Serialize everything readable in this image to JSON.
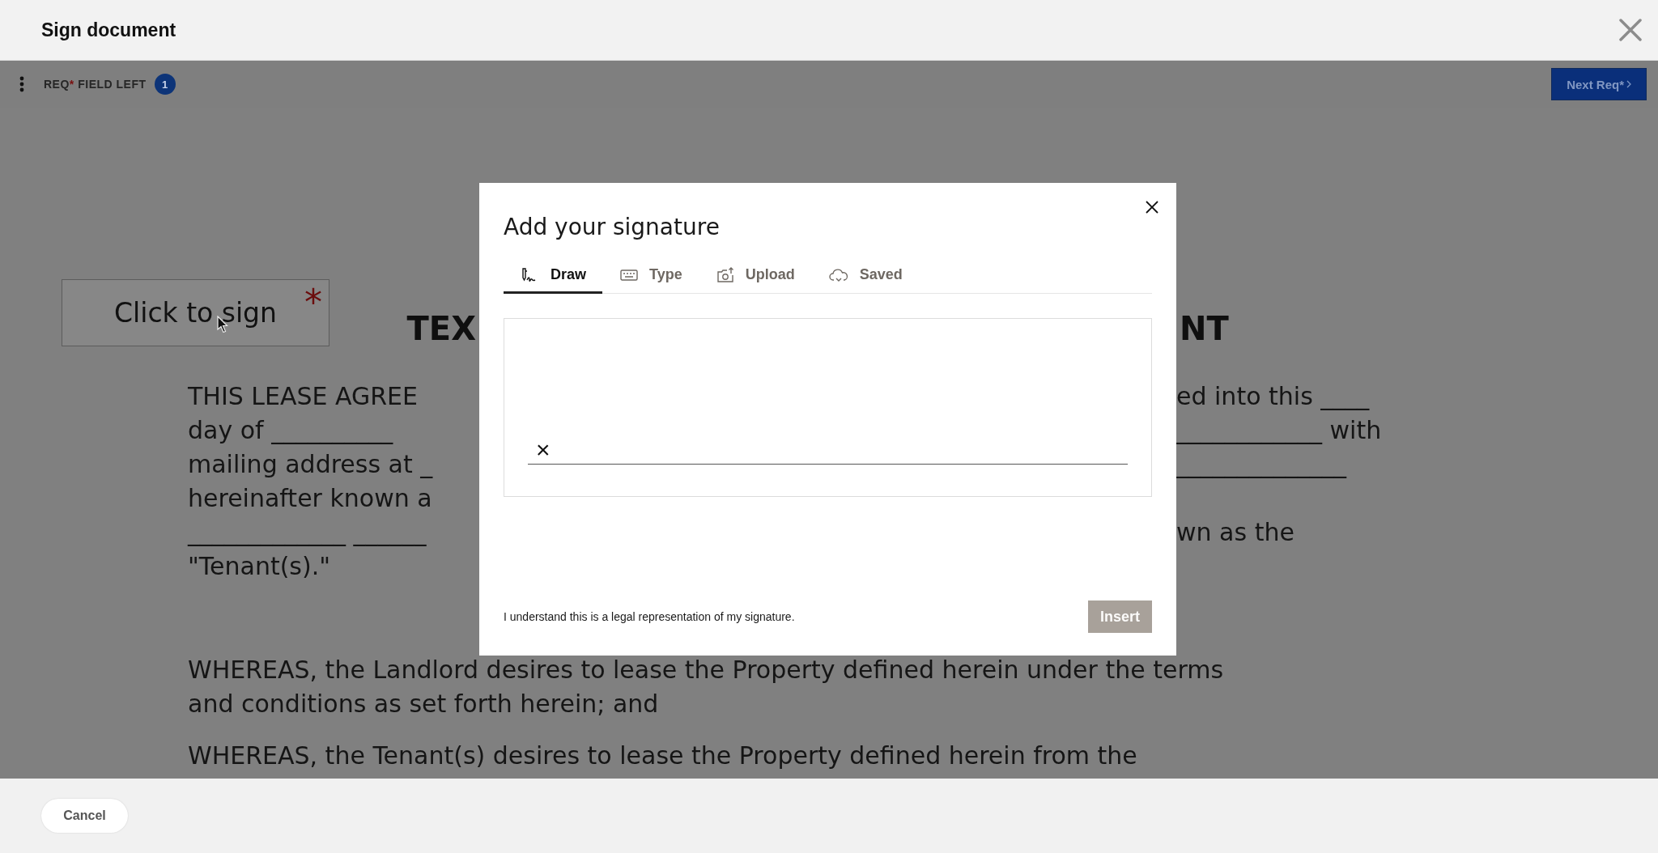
{
  "window": {
    "title": "Sign document"
  },
  "toolbar": {
    "required_label": "REQ",
    "required_mark": "*",
    "fields_left_label": "FIELD LEFT",
    "count": "1",
    "next_button": "Next Req*"
  },
  "document": {
    "sign_field": {
      "label": "Click to sign",
      "required_mark": "*"
    },
    "title": {
      "left": "TEX",
      "right": "NT"
    },
    "lines": [
      {
        "left": "THIS LEASE AGREE",
        "right": "ed into this ____"
      },
      {
        "left": "day of __________",
        "right": "____________ with"
      },
      {
        "left": "mailing address at _",
        "right": "______________"
      },
      {
        "left": "hereinafter known a"
      },
      {
        "left": "_____________ ______",
        "right": "wn as the"
      },
      {
        "left": "\"Tenant(s).\""
      },
      {
        "left": "WHEREAS, the Landlord desires to lease the Property defined herein under the terms",
        "new_paragraph": true
      },
      {
        "left": "and conditions as set forth herein; and"
      },
      {
        "left": "WHEREAS, the Tenant(s) desires to lease the Property defined herein from the",
        "new_paragraph": true
      }
    ]
  },
  "dialog": {
    "title": "Add your signature",
    "tabs": [
      {
        "label": "Draw",
        "selected": true
      },
      {
        "label": "Type",
        "selected": false
      },
      {
        "label": "Upload",
        "selected": false
      },
      {
        "label": "Saved",
        "selected": false
      }
    ],
    "pad_mark": "×",
    "consent": "I understand this is a legal representation of my signature.",
    "insert_button": {
      "label": "Insert",
      "disabled": true
    }
  },
  "footer": {
    "cancel_button": "Cancel"
  }
}
